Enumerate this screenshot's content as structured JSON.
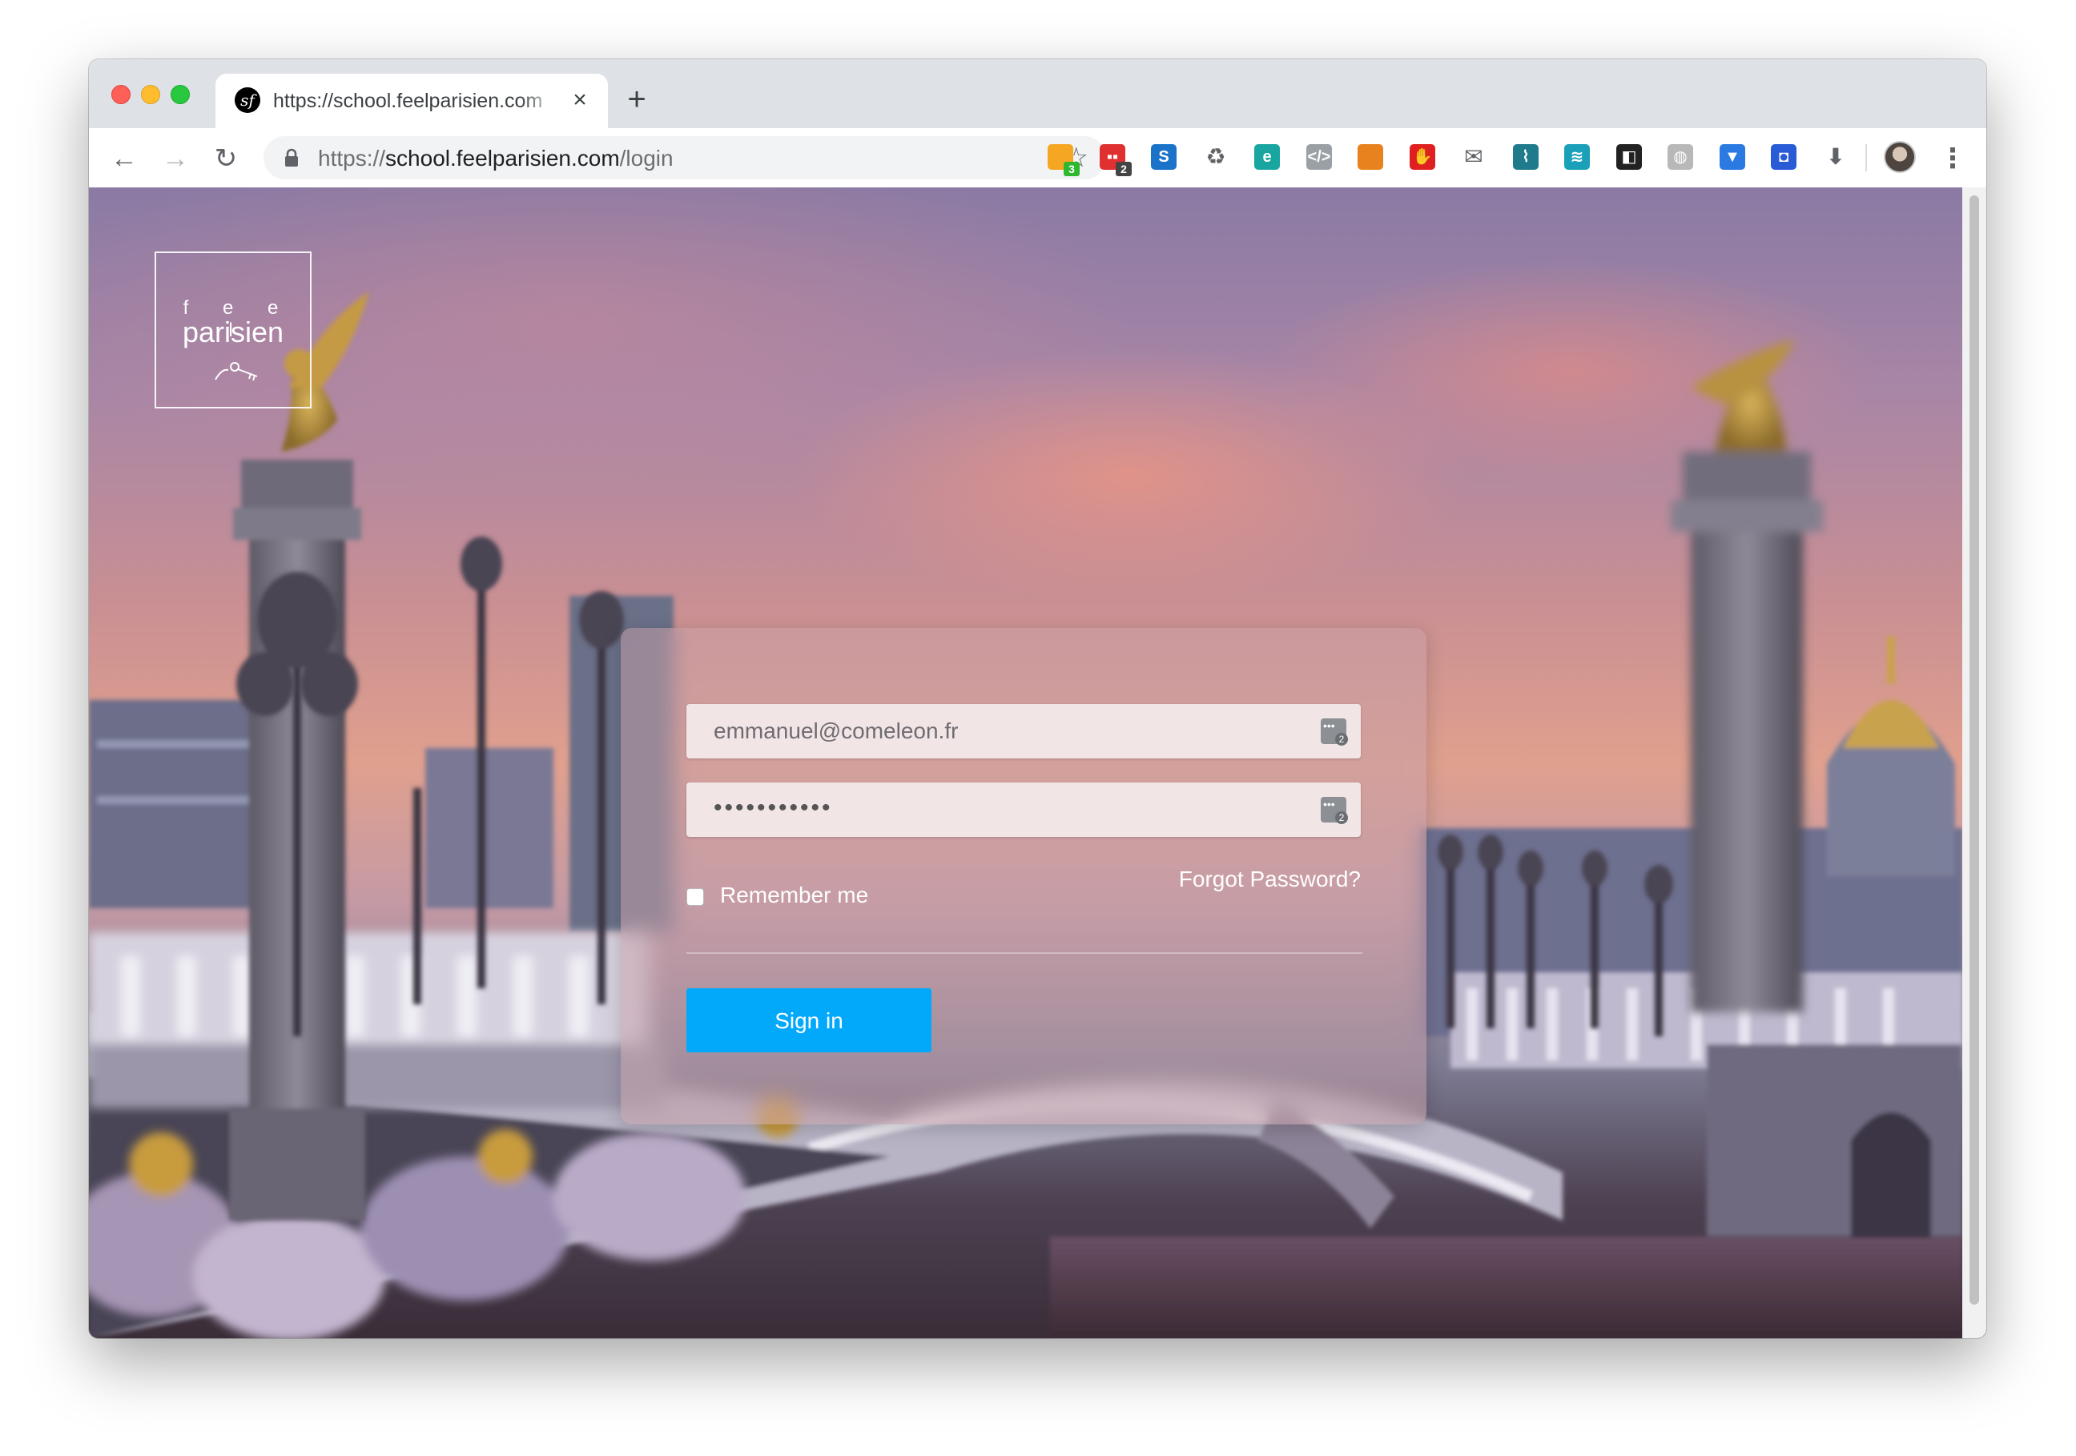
{
  "browser": {
    "tab_title": "https://school.feelparisien.com",
    "tab_close_glyph": "×",
    "new_tab_glyph": "+",
    "favicon_glyph": "sf",
    "url_scheme": "https://",
    "url_host": "school.feelparisien.com",
    "url_path": "/login",
    "back_glyph": "←",
    "forward_glyph": "→",
    "reload_glyph": "↻",
    "bookmark_glyph": "☆",
    "menu_glyph": "⋮",
    "extensions": [
      {
        "name": "download-manager-extension-icon",
        "label": "",
        "badge": "3",
        "color": "#f5a623",
        "badge_color": "#2fb72f"
      },
      {
        "name": "todoist-extension-icon",
        "label": "▪▪",
        "badge": "2",
        "color": "#e03030",
        "badge_color": "#444444"
      },
      {
        "name": "s-extension-icon",
        "label": "S",
        "badge": "",
        "color": "#1a73c9",
        "badge_color": ""
      },
      {
        "name": "recycle-extension-icon",
        "label": "♻",
        "badge": "",
        "color": "#ffffff",
        "badge_color": ""
      },
      {
        "name": "e-circle-extension-icon",
        "label": "e",
        "badge": "",
        "color": "#1aa6a0",
        "badge_color": ""
      },
      {
        "name": "code-extension-icon",
        "label": "</>",
        "badge": "",
        "color": "#9aa0a6",
        "badge_color": ""
      },
      {
        "name": "metamask-extension-icon",
        "label": "",
        "badge": "",
        "color": "#e8821e",
        "badge_color": ""
      },
      {
        "name": "adblock-extension-icon",
        "label": "✋",
        "badge": "",
        "color": "#e02020",
        "badge_color": ""
      },
      {
        "name": "mail-extension-icon",
        "label": "✉",
        "badge": "",
        "color": "#ffffff",
        "badge_color": ""
      },
      {
        "name": "graph-extension-icon",
        "label": "⌇",
        "badge": "",
        "color": "#1f7a8c",
        "badge_color": ""
      },
      {
        "name": "wave-extension-icon",
        "label": "≋",
        "badge": "",
        "color": "#1aa0b8",
        "badge_color": ""
      },
      {
        "name": "dark-reader-extension-icon",
        "label": "◧",
        "badge": "",
        "color": "#222222",
        "badge_color": ""
      },
      {
        "name": "globe-extension-icon",
        "label": "◍",
        "badge": "",
        "color": "#b8b8b8",
        "badge_color": ""
      },
      {
        "name": "vuejs-extension-icon",
        "label": "▼",
        "badge": "",
        "color": "#2a7ae2",
        "badge_color": ""
      },
      {
        "name": "box-extension-icon",
        "label": "◘",
        "badge": "",
        "color": "#2a5bd7",
        "badge_color": ""
      },
      {
        "name": "download-arrow-extension-icon",
        "label": "⬇",
        "badge": "",
        "color": "#ffffff",
        "badge_color": ""
      }
    ]
  },
  "logo": {
    "small_text": "f e e l",
    "big_text": "parisien"
  },
  "login": {
    "email_value": "emmanuel@comeleon.fr",
    "password_value": "•••••••••••",
    "password_manager_badge": "2",
    "remember_label": "Remember me",
    "remember_checked": false,
    "forgot_label": "Forgot Password?",
    "signin_label": "Sign in"
  },
  "colors": {
    "accent": "#02a9fb",
    "close": "#fe5f57",
    "minimize": "#febc2e",
    "maximize": "#28c840"
  }
}
